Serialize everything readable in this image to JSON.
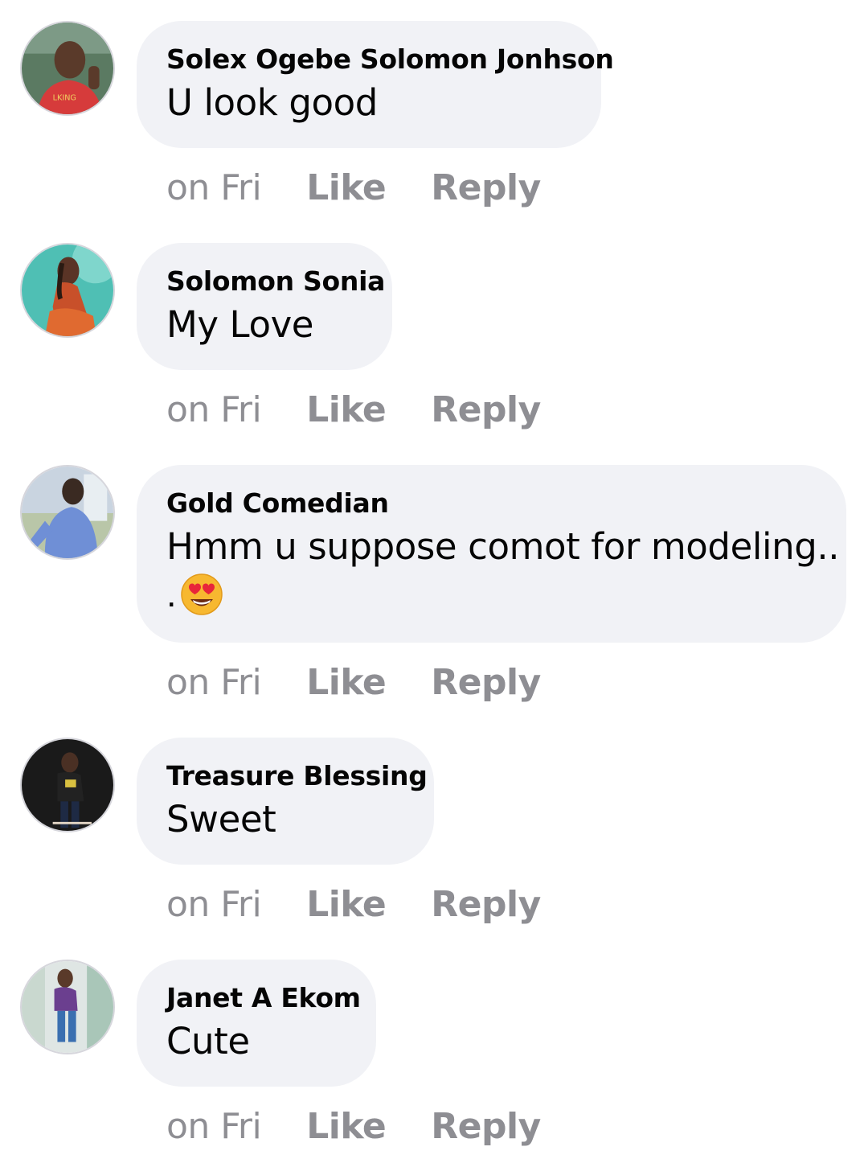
{
  "comments": [
    {
      "author": "Solex Ogebe Solomon Jonhson",
      "text": "U look good",
      "time": "on Fri",
      "like_label": "Like",
      "reply_label": "Reply",
      "avatar_colors": {
        "bg": "#5b7a62",
        "shirt": "#d63b3b",
        "skin": "#5a3a2a"
      }
    },
    {
      "author": "Solomon Sonia",
      "text": "My Love",
      "time": "on Fri",
      "like_label": "Like",
      "reply_label": "Reply",
      "avatar_colors": {
        "bg": "#4fbfb4",
        "shirt": "#c8502a",
        "skin": "#5a3426"
      }
    },
    {
      "author": "Gold Comedian",
      "text": "Hmm u suppose comot for modeling..",
      "text_line2": ".",
      "emoji": "heart-eyes-emoji",
      "time": "on Fri",
      "like_label": "Like",
      "reply_label": "Reply",
      "avatar_colors": {
        "bg": "#c9d4e0",
        "shirt": "#6f8fd6",
        "skin": "#3a2a22"
      }
    },
    {
      "author": "Treasure Blessing",
      "text": "Sweet",
      "time": "on Fri",
      "like_label": "Like",
      "reply_label": "Reply",
      "avatar_colors": {
        "bg": "#1a1a1a",
        "shirt": "#222222",
        "skin": "#4a3024"
      }
    },
    {
      "author": "Janet A Ekom",
      "text": "Cute",
      "time": "on Fri",
      "like_label": "Like",
      "reply_label": "Reply",
      "avatar_colors": {
        "bg": "#dfe6e4",
        "shirt": "#6b3f8f",
        "skin": "#5a3a2a"
      }
    }
  ],
  "colors": {
    "bubble": "#f1f2f6",
    "text": "#050505",
    "meta": "#8e8e93"
  }
}
